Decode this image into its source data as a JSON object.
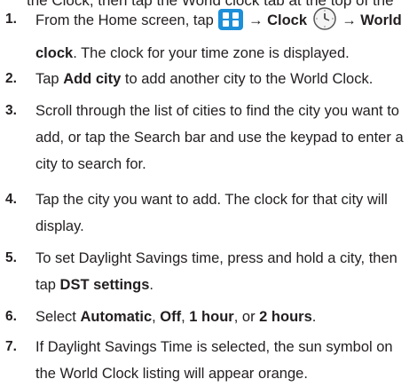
{
  "cut_line": "the Clock, then tap the World clock tab at the top of the",
  "steps": [
    {
      "num": "1.",
      "parts": [
        {
          "t": "From the Home screen, tap "
        },
        {
          "icon": "apps-grid-icon"
        },
        {
          "t": " → Clock ",
          "b": true
        },
        {
          "icon": "clock-icon"
        },
        {
          "t": " → World clock",
          "b": true
        },
        {
          "t": ". The clock for your time zone is displayed."
        }
      ]
    },
    {
      "num": "2.",
      "parts": [
        {
          "t": "Tap "
        },
        {
          "t": "Add city",
          "b": true
        },
        {
          "t": " to add another city to the World Clock."
        }
      ]
    },
    {
      "num": "3.",
      "parts": [
        {
          "t": "Scroll through the list of cities to find the city you want to add, or tap the Search bar and use the keypad to enter a city to search for."
        }
      ]
    },
    {
      "num": "4.",
      "parts": [
        {
          "t": "Tap the city you want to add. The clock for that city will display."
        }
      ]
    },
    {
      "num": "5.",
      "parts": [
        {
          "t": "To set Daylight Savings time, press and hold a city, then tap "
        },
        {
          "t": "DST settings",
          "b": true
        },
        {
          "t": "."
        }
      ]
    },
    {
      "num": "6.",
      "parts": [
        {
          "t": "Select "
        },
        {
          "t": "Automatic",
          "b": true
        },
        {
          "t": ", "
        },
        {
          "t": "Off",
          "b": true
        },
        {
          "t": ", "
        },
        {
          "t": "1 hour",
          "b": true
        },
        {
          "t": ", or "
        },
        {
          "t": "2 hours",
          "b": true
        },
        {
          "t": "."
        }
      ]
    },
    {
      "num": "7.",
      "parts": [
        {
          "t": "If Daylight Savings Time is selected, the sun symbol on the World Clock listing will appear orange."
        }
      ]
    }
  ],
  "colors": {
    "text": "#231f20",
    "apps_icon": "#1c8fd9"
  }
}
